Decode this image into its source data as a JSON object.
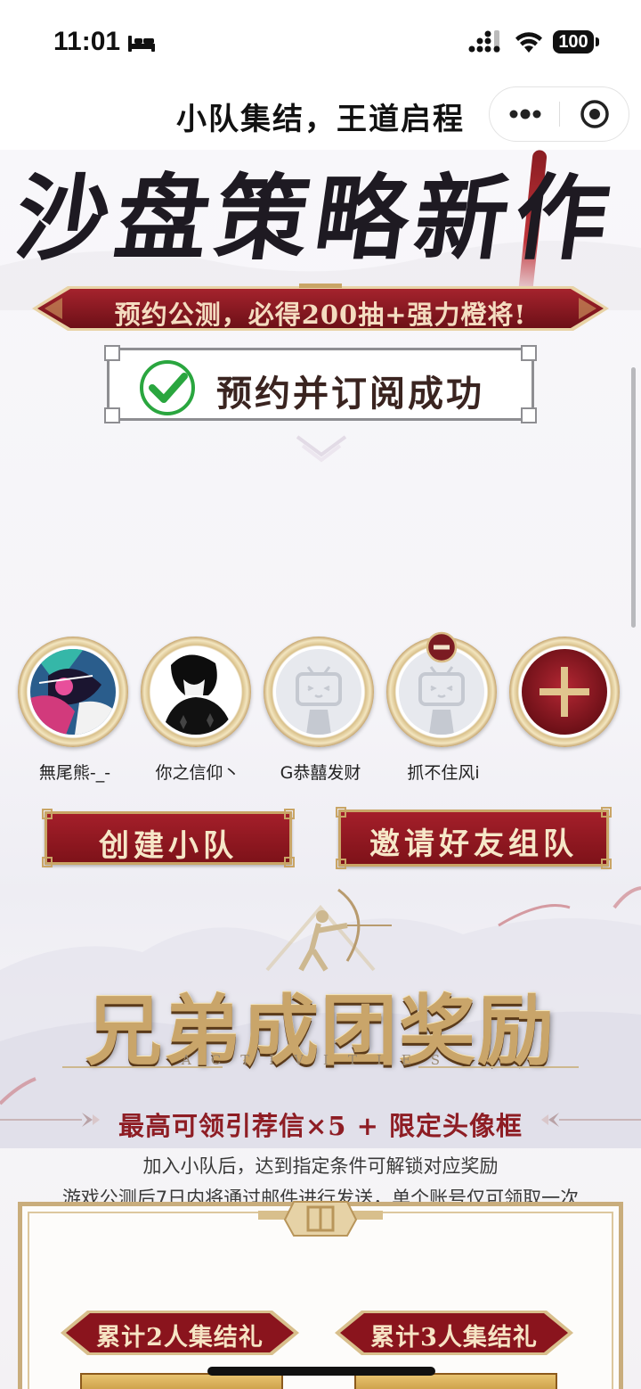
{
  "status_bar": {
    "time": "11:01",
    "battery": "100"
  },
  "navbar": {
    "title": "小队集结，王道启程"
  },
  "hero": {
    "headline": "沙盘策略新作",
    "banner": "预约公测，必得200抽+强力橙将!",
    "subscribed": "预约并订阅成功"
  },
  "team": {
    "members": [
      {
        "name": "無尾熊-_-",
        "avatar": "anime-art"
      },
      {
        "name": "你之信仰丶",
        "avatar": "dark-portrait"
      },
      {
        "name": "G恭囍发财",
        "avatar": "default-tv"
      },
      {
        "name": "抓不住风i",
        "avatar": "default-tv"
      }
    ],
    "add_icon": "plus-icon"
  },
  "actions": {
    "create": "创建小队",
    "invite": "邀请好友组队"
  },
  "rewards": {
    "title": "兄弟成团奖励",
    "subtitle": "ACTIVITIES",
    "highlight": "最高可领引荐信×5 + 限定头像框",
    "desc1": "加入小队后，达到指定条件可解锁对应奖励",
    "desc2": "游戏公测后7日内将通过邮件进行发送，单个账号仅可领取一次",
    "tiers": [
      "累计2人集结礼",
      "累计3人集结礼"
    ]
  },
  "colors": {
    "crimson": "#8e1d24",
    "gold": "#c9a566",
    "ink": "#1e1a22"
  }
}
